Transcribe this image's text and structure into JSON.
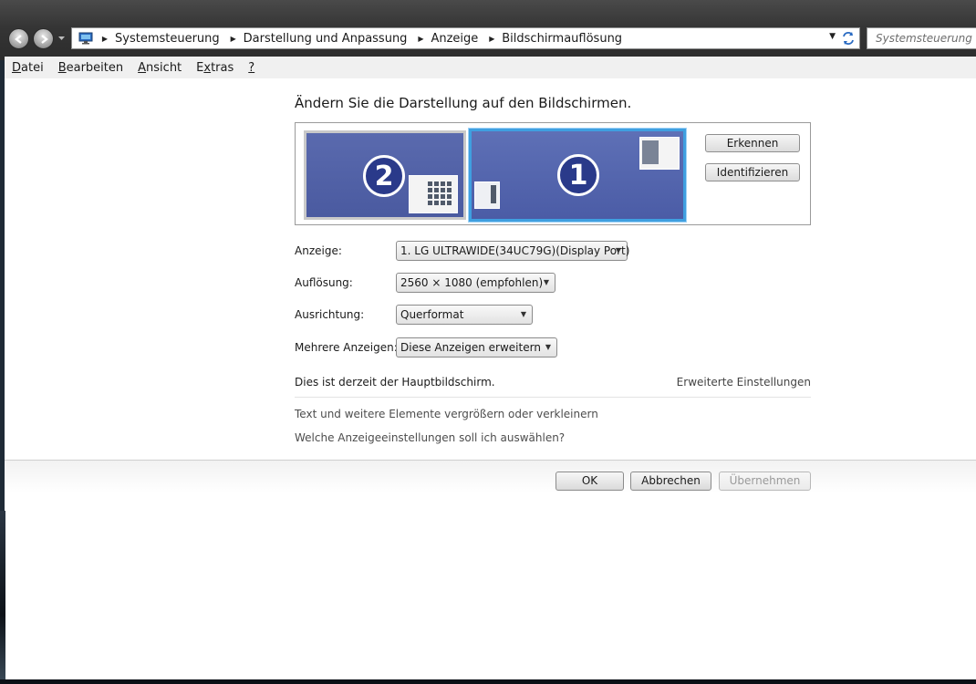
{
  "address": {
    "breadcrumbs": [
      "Systemsteuerung",
      "Darstellung und Anpassung",
      "Anzeige",
      "Bildschirmauflösung"
    ]
  },
  "search": {
    "placeholder": "Systemsteuerung du"
  },
  "menu": {
    "items": [
      {
        "accel": "D",
        "rest": "atei"
      },
      {
        "accel": "B",
        "rest": "earbeiten"
      },
      {
        "accel": "A",
        "rest": "nsicht"
      },
      {
        "pre": "E",
        "accel": "x",
        "rest": "tras"
      },
      {
        "accel": "?",
        "rest": ""
      }
    ]
  },
  "page": {
    "title": "Ändern Sie die Darstellung auf den Bildschirmen.",
    "monitors": [
      {
        "number": "2",
        "selected": false
      },
      {
        "number": "1",
        "selected": true
      }
    ],
    "buttons": {
      "detect": "Erkennen",
      "identify": "Identifizieren"
    },
    "fields": {
      "display_label": "Anzeige:",
      "display_value": "1. LG ULTRAWIDE(34UC79G)(Display Port)",
      "resolution_label": "Auflösung:",
      "resolution_value": "2560 × 1080 (empfohlen)",
      "orientation_label": "Ausrichtung:",
      "orientation_value": "Querformat",
      "multiple_label": "Mehrere Anzeigen:",
      "multiple_value": "Diese Anzeigen erweitern"
    },
    "primary_text": "Dies ist derzeit der Hauptbildschirm.",
    "advanced_link": "Erweiterte Einstellungen",
    "links": [
      "Text und weitere Elemente vergrößern oder verkleinern",
      "Welche Anzeigeeinstellungen soll ich auswählen?"
    ]
  },
  "dialog": {
    "ok": "OK",
    "cancel": "Abbrechen",
    "apply": "Übernehmen"
  },
  "colors": {
    "selected_monitor_border": "#3f9fe0",
    "monitor_fill": "#4b5ca6"
  }
}
